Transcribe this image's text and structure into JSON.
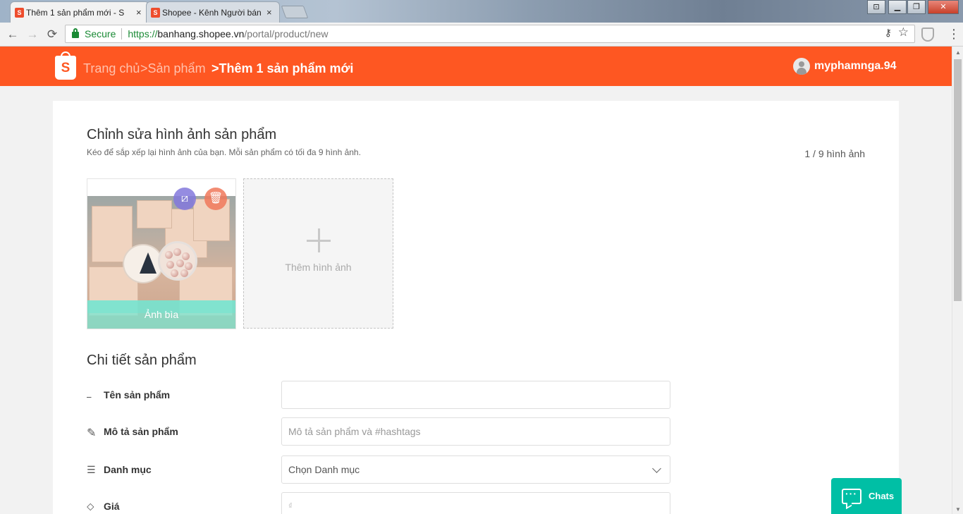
{
  "browser": {
    "tabs": [
      {
        "label": "Thêm 1 sản phẩm mới - S",
        "active": true
      },
      {
        "label": "Shopee - Kênh Người bán",
        "active": false
      }
    ],
    "tab_close": "×",
    "window_controls": {
      "minimize": "▁",
      "maximize": "❐",
      "close": "✕"
    },
    "nav": {
      "back": "←",
      "forward": "→",
      "reload": "⟳"
    },
    "address": {
      "secure_label": "Secure",
      "protocol": "https://",
      "host": "banhang.shopee.vn",
      "path": "/portal/product/new"
    },
    "key_icon": "⚷",
    "star_icon": "☆",
    "menu_icon": "⋮"
  },
  "header": {
    "logo_letter": "S",
    "breadcrumbs": [
      "Trang chủ",
      " >Sản phẩm",
      " >Thêm 1 sản phẩm mới"
    ],
    "username": "myphamnga.94",
    "brand_color": "#fe5722"
  },
  "images_section": {
    "title": "Chỉnh sửa hình ảnh sản phẩm",
    "subtitle": "Kéo để sắp xếp lại hình ảnh của bạn. Mỗi sản phẩm có tối đa 9 hình ảnh.",
    "count": "1 / 9 hình ảnh",
    "cover_label": "Ảnh bìa",
    "crop_icon": "⧄",
    "delete_icon": "🗑",
    "add_image_label": "Thêm hình ảnh"
  },
  "details_section": {
    "title": "Chi tiết sản phẩm",
    "fields": [
      {
        "icon": "name-icon",
        "glyph": "⎯",
        "label": "Tên sản phẩm",
        "value": "",
        "placeholder": ""
      },
      {
        "icon": "pencil-icon",
        "glyph": "✎",
        "label": "Mô tả sản phẩm",
        "value": "",
        "placeholder": "Mô tả sản phẩm và #hashtags"
      },
      {
        "icon": "list-icon",
        "glyph": "☰",
        "label": "Danh mục",
        "value": "Chọn Danh mục",
        "placeholder": ""
      },
      {
        "icon": "tag-icon",
        "glyph": "⬦",
        "label": "Giá",
        "value": "",
        "placeholder": "₫"
      }
    ]
  },
  "chat": {
    "label": "Chats",
    "color": "#00bfa5"
  }
}
